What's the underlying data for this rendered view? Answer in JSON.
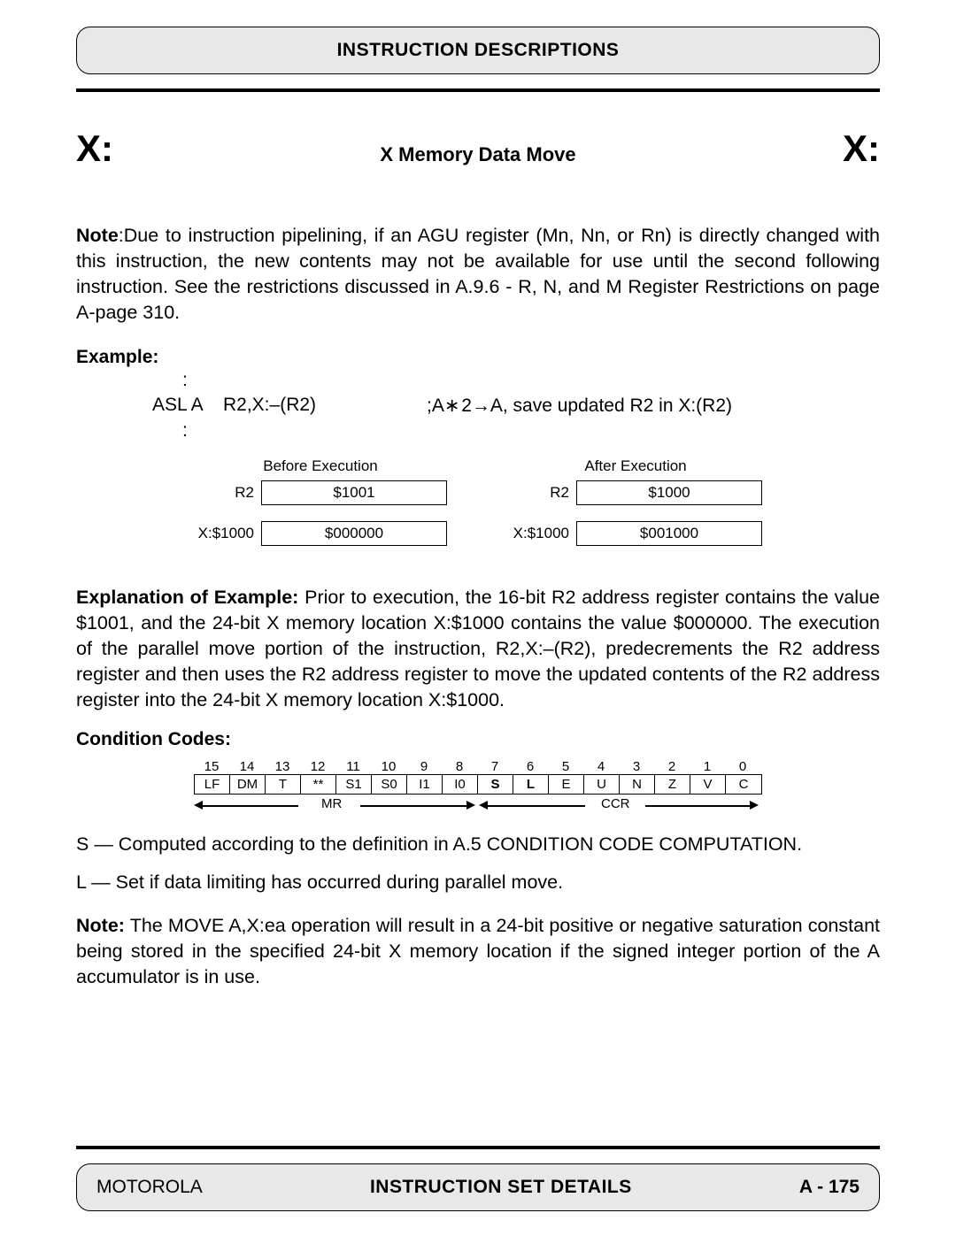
{
  "header": {
    "title": "INSTRUCTION DESCRIPTIONS"
  },
  "title": {
    "left": "X:",
    "center": "X Memory Data Move",
    "right": "X:"
  },
  "note1": {
    "label": "Note",
    "text": ":Due to instruction pipelining, if an AGU register (Mn, Nn, or Rn) is directly changed with this instruction, the new contents may not be available for use until the second following instruction. See the restrictions discussed in A.9.6 - R, N, and M Register Restrictions on page A-page 310."
  },
  "example": {
    "label": "Example:",
    "colon": ":",
    "mnemonic": "ASL A",
    "operands": "R2,X:–(R2)",
    "comment": ";A∗ 2→A, save updated R2 in X:(R2)"
  },
  "exec": {
    "before": {
      "title": "Before Execution",
      "rows": [
        {
          "label": "R2",
          "value": "$1001"
        },
        {
          "label": "X:$1000",
          "value": "$000000"
        }
      ]
    },
    "after": {
      "title": "After Execution",
      "rows": [
        {
          "label": "R2",
          "value": "$1000"
        },
        {
          "label": "X:$1000",
          "value": "$001000"
        }
      ]
    }
  },
  "explanation": {
    "label": "Explanation of Example:",
    "text": " Prior to execution, the 16-bit R2 address register contains the value $1001, and the 24-bit X memory location X:$1000 contains the value $000000. The execution of the parallel move portion of the instruction, R2,X:–(R2), predecrements the R2 address register and then uses the R2 address register to move the updated contents of the R2 address register into the 24-bit X memory location X:$1000."
  },
  "cc": {
    "label": "Condition Codes:",
    "nums": [
      "15",
      "14",
      "13",
      "12",
      "11",
      "10",
      "9",
      "8",
      "7",
      "6",
      "5",
      "4",
      "3",
      "2",
      "1",
      "0"
    ],
    "bits": [
      "LF",
      "DM",
      "T",
      "**",
      "S1",
      "S0",
      "I1",
      "I0",
      "S",
      "L",
      "E",
      "U",
      "N",
      "Z",
      "V",
      "C"
    ],
    "bold_bits": [
      8,
      9
    ],
    "mr": "MR",
    "ccr": "CCR",
    "lines": [
      "S — Computed according to the definition in A.5 CONDITION CODE COMPUTATION.",
      "L — Set if data limiting has occurred during parallel move."
    ]
  },
  "note2": {
    "label": "Note:",
    "text": " The MOVE A,X:ea operation will result in a 24-bit positive or negative saturation constant being stored in the specified 24-bit X memory location if the signed integer portion of the A accumulator is in use."
  },
  "footer": {
    "left": "MOTOROLA",
    "center": "INSTRUCTION SET DETAILS",
    "right": "A - 175"
  }
}
